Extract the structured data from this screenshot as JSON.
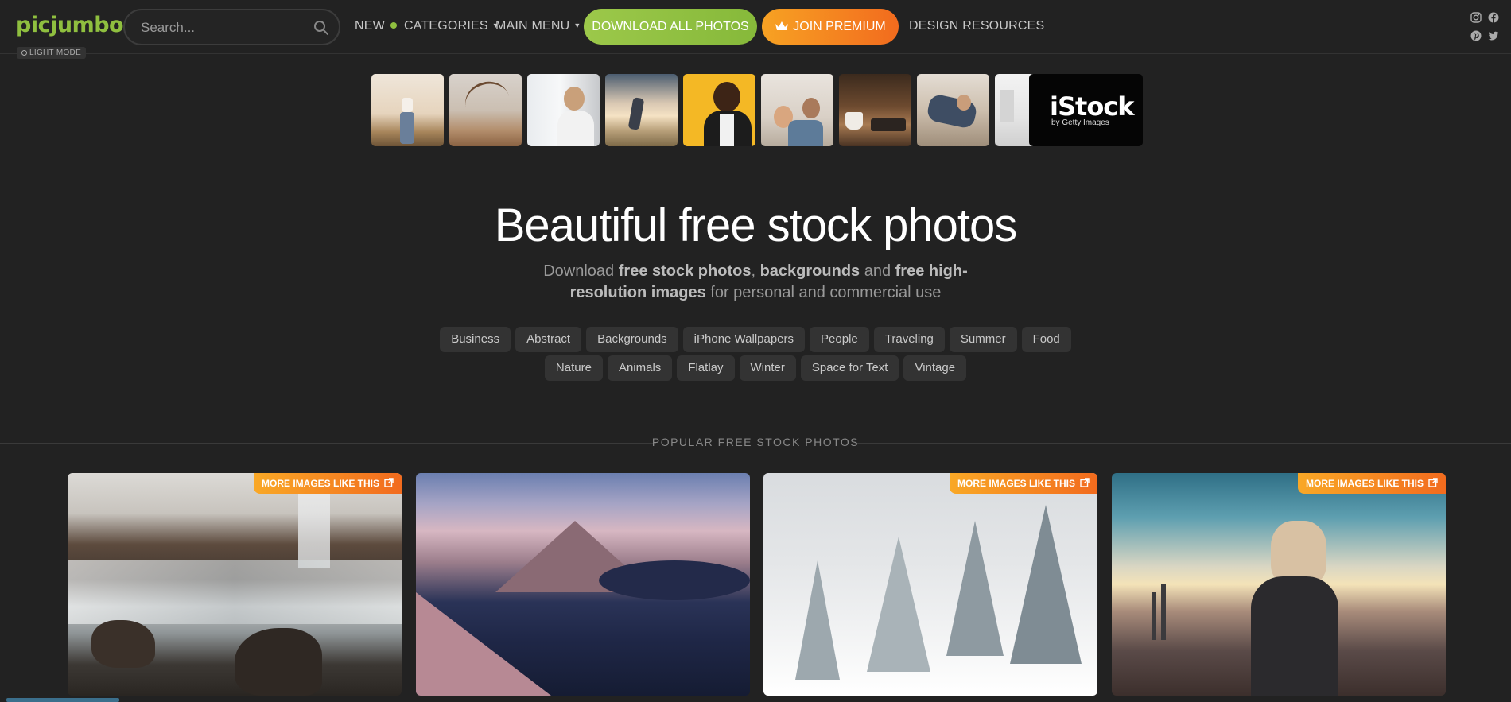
{
  "header": {
    "logo": "picjumbo",
    "light_mode": "LIGHT MODE",
    "search_placeholder": "Search...",
    "nav": {
      "new": "NEW",
      "categories": "CATEGORIES",
      "main_menu": "MAIN MENU",
      "design_resources": "DESIGN RESOURCES"
    },
    "download_all": "DOWNLOAD ALL PHOTOS",
    "join_premium": "JOIN PREMIUM",
    "social": [
      "instagram-icon",
      "facebook-icon",
      "pinterest-icon",
      "twitter-icon"
    ]
  },
  "strip": {
    "thumbnails": [
      "family-outdoor",
      "windy-hair",
      "woman-window",
      "field-sunset",
      "man-yellow",
      "family-couch",
      "coffee-desk",
      "woman-bed",
      "white-room"
    ],
    "istock_title": "iStock",
    "istock_sub": "by Getty Images"
  },
  "hero": {
    "title": "Beautiful free stock photos",
    "sub_1": "Download ",
    "sub_b1": "free stock photos",
    "sub_2": ", ",
    "sub_b2": "backgrounds",
    "sub_3": " and ",
    "sub_b3": "free high-resolution images",
    "sub_4": " for personal and commercial use"
  },
  "tags_row1": [
    "Business",
    "Abstract",
    "Backgrounds",
    "iPhone Wallpapers",
    "People",
    "Traveling",
    "Summer",
    "Food"
  ],
  "tags_row2": [
    "Nature",
    "Animals",
    "Flatlay",
    "Winter",
    "Space for Text",
    "Vintage"
  ],
  "section_title": "POPULAR FREE STOCK PHOTOS",
  "cards": [
    {
      "badge": "MORE IMAGES LIKE THIS",
      "scene": "waterfall-rocks"
    },
    {
      "badge": "",
      "scene": "mountain-fjord"
    },
    {
      "badge": "MORE IMAGES LIKE THIS",
      "scene": "snowy-trees"
    },
    {
      "badge": "MORE IMAGES LIKE THIS",
      "scene": "woman-sunset"
    }
  ],
  "colors": {
    "background": "#222222",
    "brand_green": "#8fbf3f",
    "premium_orange": "#f26b1e"
  }
}
